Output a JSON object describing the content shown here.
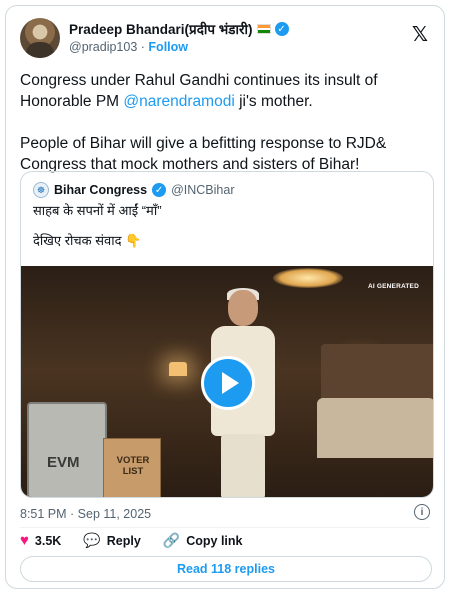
{
  "author": {
    "name": "Pradeep Bhandari(प्रदीप भंडारी)",
    "handle": "@pradip103",
    "follow_label": "Follow"
  },
  "tweet": {
    "line1_prefix": "Congress under Rahul Gandhi continues its insult of Honorable PM ",
    "mention": "@narendramodi",
    "line1_suffix": " ji's mother.",
    "line2": "People of Bihar will give a befitting response to RJD& Congress that mock mothers and sisters of Bihar!"
  },
  "quoted": {
    "name": "Bihar Congress",
    "handle": "@INCBihar",
    "text1": "साहब के सपनों में आईं “माँ”",
    "text2": "देखिए रोचक संवाद 👇",
    "video_tag": "AI GENERATED",
    "evm_label": "EVM",
    "voter_label": "VOTER LIST"
  },
  "timestamp": "8:51 PM · Sep 11, 2025",
  "actions": {
    "likes": "3.5K",
    "reply_label": "Reply",
    "copy_label": "Copy link"
  },
  "read_replies_label": "Read 118 replies",
  "icons": [
    "x-logo-icon",
    "verified-icon",
    "info-icon",
    "heart-icon",
    "reply-icon",
    "link-icon",
    "play-icon"
  ],
  "colors": {
    "accent": "#1d9bf0",
    "like": "#f91880",
    "text": "#0f1419",
    "muted": "#536471"
  }
}
